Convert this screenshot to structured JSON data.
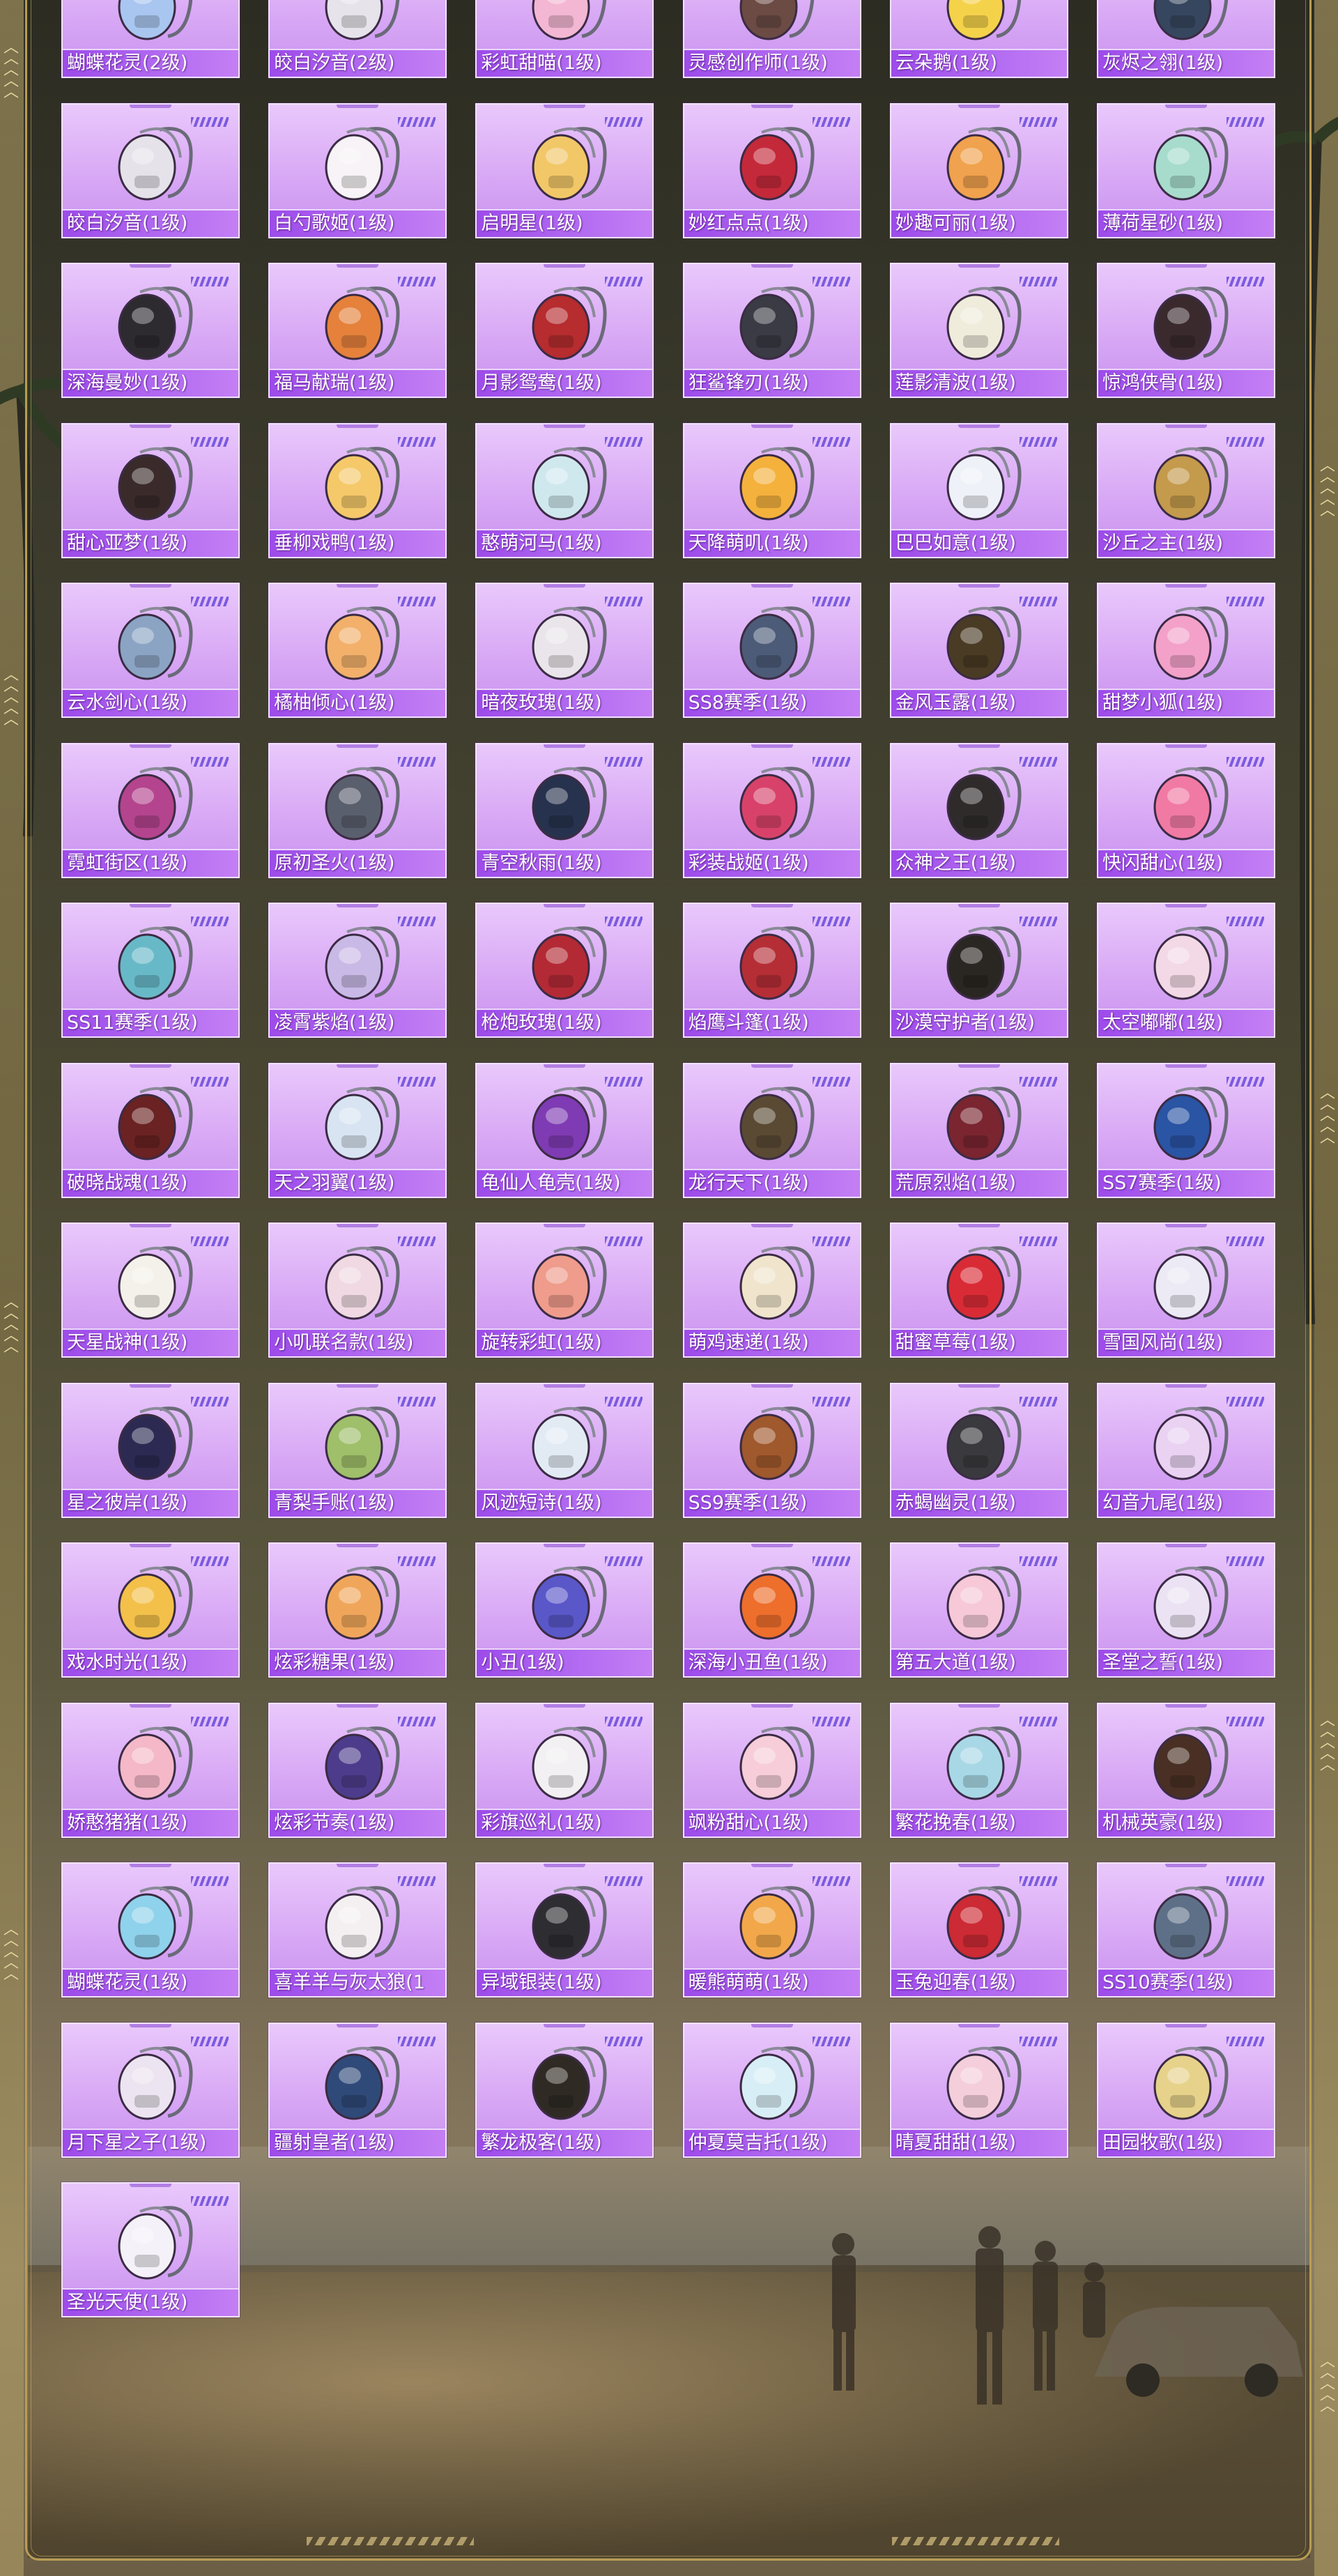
{
  "inventory": {
    "items": [
      {
        "name": "蝴蝶花灵(2级)",
        "icon": "butterfly-backpack-icon",
        "color": "#a9c6f0"
      },
      {
        "name": "皎白汐音(2级)",
        "icon": "bunny-backpack-icon",
        "color": "#e6e3ea"
      },
      {
        "name": "彩虹甜喵(1级)",
        "icon": "cat-backpack-icon",
        "color": "#f3b7d3"
      },
      {
        "name": "灵感创作师(1级)",
        "icon": "checkered-backpack-icon",
        "color": "#6b4b44"
      },
      {
        "name": "云朵鹅(1级)",
        "icon": "flower-backpack-icon",
        "color": "#f4d24a"
      },
      {
        "name": "灰烬之翎(1级)",
        "icon": "ring-backpack-icon",
        "color": "#37465f"
      },
      {
        "name": "皎白汐音(1级)",
        "icon": "strap-backpack-icon",
        "color": "#e5e2ea"
      },
      {
        "name": "白勺歌姬(1级)",
        "icon": "bunny-backpack-icon",
        "color": "#f7f3f6"
      },
      {
        "name": "启明星(1级)",
        "icon": "star-backpack-icon",
        "color": "#f2c768"
      },
      {
        "name": "妙红点点(1级)",
        "icon": "round-backpack-icon",
        "color": "#c4293a"
      },
      {
        "name": "妙趣可丽(1级)",
        "icon": "crepe-backpack-icon",
        "color": "#f0a24e"
      },
      {
        "name": "薄荷星砂(1级)",
        "icon": "mint-backpack-icon",
        "color": "#a7dccd"
      },
      {
        "name": "深海曼妙(1级)",
        "icon": "dark-backpack-icon",
        "color": "#2d2a30"
      },
      {
        "name": "福马献瑞(1级)",
        "icon": "horse-backpack-icon",
        "color": "#e5813b"
      },
      {
        "name": "月影鸳鸯(1级)",
        "icon": "ornate-backpack-icon",
        "color": "#b62c2f"
      },
      {
        "name": "狂鲨锋刃(1级)",
        "icon": "shark-backpack-icon",
        "color": "#3a3b44"
      },
      {
        "name": "莲影清波(1级)",
        "icon": "lotus-backpack-icon",
        "color": "#f0ecdc"
      },
      {
        "name": "惊鸿侠骨(1级)",
        "icon": "armor-backpack-icon",
        "color": "#3a2a2e"
      },
      {
        "name": "甜心亚梦(1级)",
        "icon": "cat-ear-backpack-icon",
        "color": "#3a2a2a"
      },
      {
        "name": "垂柳戏鸭(1级)",
        "icon": "duck-backpack-icon",
        "color": "#f5c96a"
      },
      {
        "name": "憨萌河马(1级)",
        "icon": "hippo-backpack-icon",
        "color": "#cfe8ee"
      },
      {
        "name": "天降萌叽(1级)",
        "icon": "chick-backpack-icon",
        "color": "#f4b13c"
      },
      {
        "name": "巴巴如意(1级)",
        "icon": "bunny-backpack-icon",
        "color": "#eef1f8"
      },
      {
        "name": "沙丘之主(1级)",
        "icon": "sword-backpack-icon",
        "color": "#c49a4c"
      },
      {
        "name": "云水剑心(1级)",
        "icon": "strap-backpack-icon",
        "color": "#8ba4c4"
      },
      {
        "name": "橘柚倾心(1级)",
        "icon": "orange-backpack-icon",
        "color": "#f2b06a"
      },
      {
        "name": "暗夜玫瑰(1级)",
        "icon": "rabbit-backpack-icon",
        "color": "#e9e5ea"
      },
      {
        "name": "SS8赛季(1级)",
        "icon": "tactical-backpack-icon",
        "color": "#4c5b78"
      },
      {
        "name": "金风玉露(1级)",
        "icon": "gold-backpack-icon",
        "color": "#4a3b24"
      },
      {
        "name": "甜梦小狐(1级)",
        "icon": "fox-backpack-icon",
        "color": "#f3a1c9"
      },
      {
        "name": "霓虹街区(1级)",
        "icon": "neon-backpack-icon",
        "color": "#b4448e"
      },
      {
        "name": "原初圣火(1级)",
        "icon": "flame-backpack-icon",
        "color": "#5a5f6e"
      },
      {
        "name": "青空秋雨(1级)",
        "icon": "navy-backpack-icon",
        "color": "#27324e"
      },
      {
        "name": "彩装战姬(1级)",
        "icon": "pink-backpack-icon",
        "color": "#d8426a"
      },
      {
        "name": "众神之王(1级)",
        "icon": "king-backpack-icon",
        "color": "#2f2b2b"
      },
      {
        "name": "快闪甜心(1级)",
        "icon": "camera-backpack-icon",
        "color": "#f17aa4"
      },
      {
        "name": "SS11赛季(1级)",
        "icon": "teal-backpack-icon",
        "color": "#68b9c8"
      },
      {
        "name": "凌霄紫焰(1级)",
        "icon": "purple-fox-backpack-icon",
        "color": "#c9b9e6"
      },
      {
        "name": "枪炮玫瑰(1级)",
        "icon": "rose-backpack-icon",
        "color": "#b32a35"
      },
      {
        "name": "焰鹰斗篷(1级)",
        "icon": "hawk-backpack-icon",
        "color": "#b52e36"
      },
      {
        "name": "沙漠守护者(1级)",
        "icon": "anubis-backpack-icon",
        "color": "#2a2622"
      },
      {
        "name": "太空嘟嘟(1级)",
        "icon": "space-backpack-icon",
        "color": "#f3d9e6"
      },
      {
        "name": "破晓战魂(1级)",
        "icon": "warrior-backpack-icon",
        "color": "#6a2222"
      },
      {
        "name": "天之羽翼(1级)",
        "icon": "wing-backpack-icon",
        "color": "#d8e4f2"
      },
      {
        "name": "龟仙人龟壳(1级)",
        "icon": "shell-backpack-icon",
        "color": "#7f3bb3"
      },
      {
        "name": "龙行天下(1级)",
        "icon": "dragon-backpack-icon",
        "color": "#5a4a34"
      },
      {
        "name": "荒原烈焰(1级)",
        "icon": "blaze-backpack-icon",
        "color": "#7a2530"
      },
      {
        "name": "SS7赛季(1级)",
        "icon": "blue-backpack-icon",
        "color": "#2a54a4"
      },
      {
        "name": "天星战神(1级)",
        "icon": "star-god-backpack-icon",
        "color": "#f4f1ea"
      },
      {
        "name": "小叽联名款(1级)",
        "icon": "bunny-backpack-icon",
        "color": "#f0d9e2"
      },
      {
        "name": "旋转彩虹(1级)",
        "icon": "carousel-backpack-icon",
        "color": "#ef9c8c"
      },
      {
        "name": "萌鸡速递(1级)",
        "icon": "chicken-backpack-icon",
        "color": "#f0e4cc"
      },
      {
        "name": "甜蜜草莓(1级)",
        "icon": "strawberry-backpack-icon",
        "color": "#d92b36"
      },
      {
        "name": "雪国风尚(1级)",
        "icon": "snow-backpack-icon",
        "color": "#eceaf4"
      },
      {
        "name": "星之彼岸(1级)",
        "icon": "planet-backpack-icon",
        "color": "#2c2a52"
      },
      {
        "name": "青梨手账(1级)",
        "icon": "pear-backpack-icon",
        "color": "#9fbf6a"
      },
      {
        "name": "风迹短诗(1级)",
        "icon": "poem-backpack-icon",
        "color": "#e2ebf4"
      },
      {
        "name": "SS9赛季(1级)",
        "icon": "leather-backpack-icon",
        "color": "#a0582d"
      },
      {
        "name": "赤蝎幽灵(1级)",
        "icon": "scorpion-backpack-icon",
        "color": "#3a3a3e"
      },
      {
        "name": "幻音九尾(1级)",
        "icon": "crystal-icon",
        "color": "#e9d2f2"
      },
      {
        "name": "戏水时光(1级)",
        "icon": "duck-backpack-icon",
        "color": "#f3c04a"
      },
      {
        "name": "炫彩糖果(1级)",
        "icon": "donut-backpack-icon",
        "color": "#f0a65a"
      },
      {
        "name": "小丑(1级)",
        "icon": "clown-icon",
        "color": "#5a57c9"
      },
      {
        "name": "深海小丑鱼(1级)",
        "icon": "clownfish-backpack-icon",
        "color": "#ee6e2c"
      },
      {
        "name": "第五大道(1级)",
        "icon": "avenue-backpack-icon",
        "color": "#f6c8d8"
      },
      {
        "name": "圣堂之誓(1级)",
        "icon": "heart-backpack-icon",
        "color": "#ebe3f3"
      },
      {
        "name": "娇憨猪猪(1级)",
        "icon": "pig-backpack-icon",
        "color": "#f4b8c8"
      },
      {
        "name": "炫彩节奏(1级)",
        "icon": "rhythm-backpack-icon",
        "color": "#4d3c8c"
      },
      {
        "name": "彩旗巡礼(1级)",
        "icon": "flag-backpack-icon",
        "color": "#f2f0f2"
      },
      {
        "name": "飒粉甜心(1级)",
        "icon": "pink-bag-icon",
        "color": "#f6cdd8"
      },
      {
        "name": "繁花挽春(1级)",
        "icon": "blossom-backpack-icon",
        "color": "#a8d8e6"
      },
      {
        "name": "机械英豪(1级)",
        "icon": "mech-backpack-icon",
        "color": "#4a3024"
      },
      {
        "name": "蝴蝶花灵(1级)",
        "icon": "butterfly-backpack-icon",
        "color": "#8fd2ec"
      },
      {
        "name": "喜羊羊与灰太狼(1",
        "icon": "sheep-backpack-icon",
        "color": "#f4f0f2"
      },
      {
        "name": "异域银装(1级)",
        "icon": "exotic-backpack-icon",
        "color": "#2d2d32"
      },
      {
        "name": "暖熊萌萌(1级)",
        "icon": "bear-backpack-icon",
        "color": "#f2a84a"
      },
      {
        "name": "玉兔迎春(1级)",
        "icon": "red-rabbit-backpack-icon",
        "color": "#cc2a34"
      },
      {
        "name": "SS10赛季(1级)",
        "icon": "grey-backpack-icon",
        "color": "#5e7088"
      },
      {
        "name": "月下星之子(1级)",
        "icon": "moon-backpack-icon",
        "color": "#ece4f0"
      },
      {
        "name": "疆射皇者(1级)",
        "icon": "royal-backpack-icon",
        "color": "#2f4a78"
      },
      {
        "name": "繁龙极客(1级)",
        "icon": "geek-backpack-icon",
        "color": "#2f2a24"
      },
      {
        "name": "仲夏莫吉托(1级)",
        "icon": "mojito-backpack-icon",
        "color": "#d8eef6"
      },
      {
        "name": "晴夏甜甜(1级)",
        "icon": "sweet-backpack-icon",
        "color": "#f4cedb"
      },
      {
        "name": "田园牧歌(1级)",
        "icon": "basket-backpack-icon",
        "color": "#e6d28a"
      },
      {
        "name": "圣光天使(1级)",
        "icon": "angel-backpack-icon",
        "color": "#f4f2f8"
      }
    ]
  }
}
